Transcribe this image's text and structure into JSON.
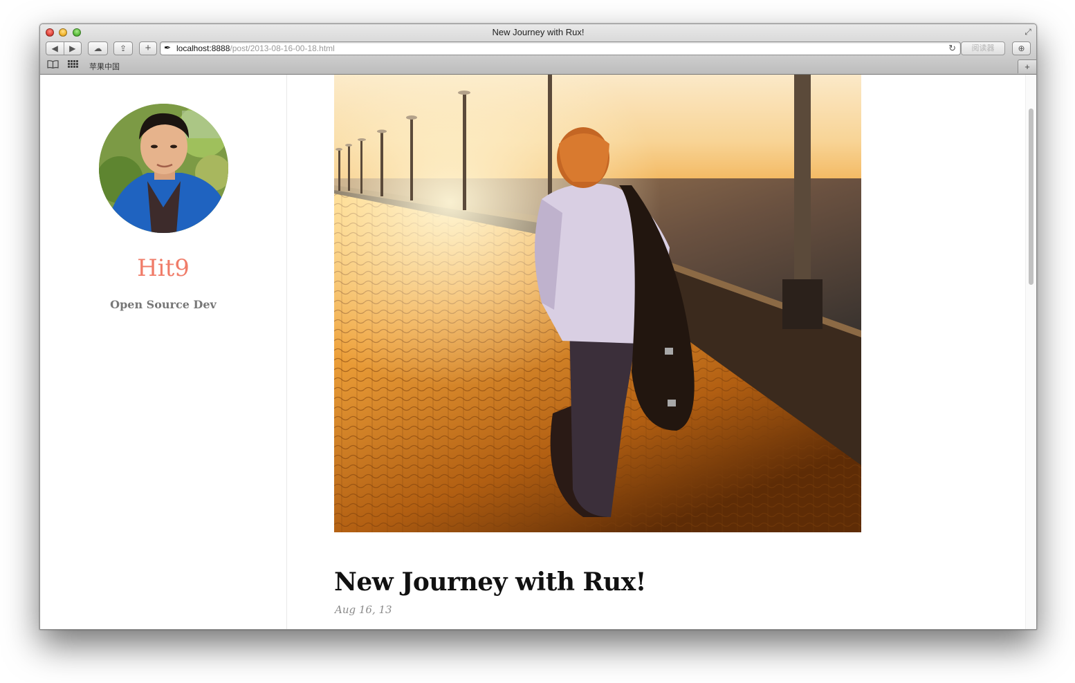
{
  "window": {
    "title": "New Journey with Rux!"
  },
  "toolbar": {
    "back_icon": "◀",
    "forward_icon": "▶",
    "icloud_icon": "☁",
    "share_icon": "⇪",
    "add_icon": "+",
    "download_icon": "⊕",
    "url_host": "localhost:8888",
    "url_path": "/post/2013-08-16-00-18.html",
    "reload_icon": "↻",
    "reader_label": "阅读器"
  },
  "bookmarks": {
    "reading_list_icon": "📖",
    "top_sites_icon": "▦",
    "items": [
      "苹果中国"
    ],
    "new_tab_icon": "+"
  },
  "sidebar": {
    "name": "Hit9",
    "tagline": "Open Source Dev"
  },
  "post": {
    "title": "New Journey with Rux!",
    "date": "Aug 16, 13"
  },
  "colors": {
    "accent": "#f07c69",
    "tagline": "#777777",
    "date": "#8a8a8a"
  }
}
